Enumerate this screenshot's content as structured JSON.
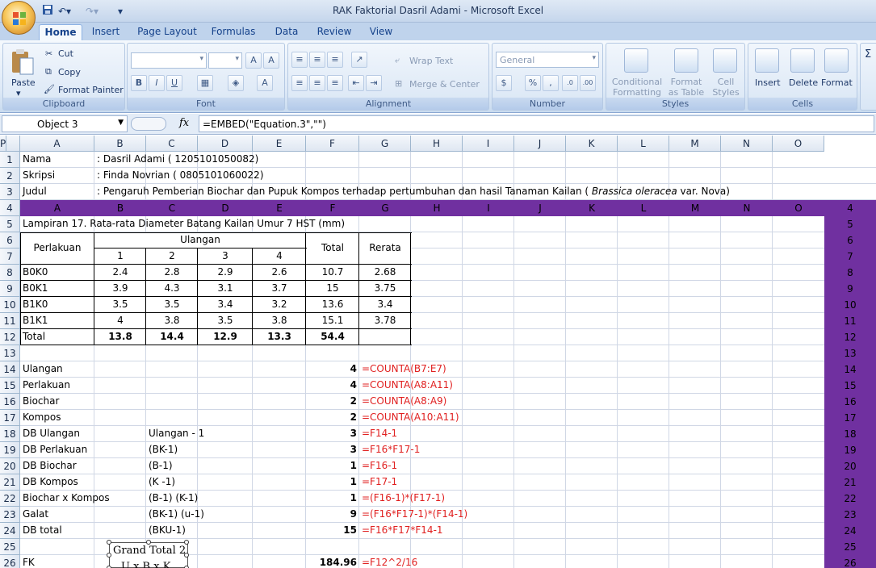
{
  "window": {
    "title": "RAK Faktorial Dasril Adami - Microsoft Excel"
  },
  "ribbon": {
    "tabs": [
      "Home",
      "Insert",
      "Page Layout",
      "Formulas",
      "Data",
      "Review",
      "View"
    ],
    "active_tab": "Home",
    "clipboard": {
      "paste": "Paste",
      "cut": "Cut",
      "copy": "Copy",
      "format_painter": "Format Painter",
      "label": "Clipboard"
    },
    "font": {
      "label": "Font"
    },
    "alignment": {
      "wrap_text": "Wrap Text",
      "merge_center": "Merge & Center",
      "label": "Alignment"
    },
    "number": {
      "format": "General",
      "label": "Number"
    },
    "styles": {
      "conditional_formatting": "Conditional Formatting",
      "format_as_table": "Format as Table",
      "cell_styles": "Cell Styles",
      "label": "Styles"
    },
    "cells": {
      "insert": "Insert",
      "delete": "Delete",
      "format": "Format",
      "label": "Cells"
    }
  },
  "formula_bar": {
    "name_box": "Object 3",
    "fx": "fx",
    "formula": "=EMBED(\"Equation.3\",\"\")"
  },
  "columns": [
    "A",
    "B",
    "C",
    "D",
    "E",
    "F",
    "G",
    "H",
    "I",
    "J",
    "K",
    "L",
    "M",
    "N",
    "O",
    "P"
  ],
  "rows": [
    "1",
    "2",
    "3",
    "4",
    "5",
    "6",
    "7",
    "8",
    "9",
    "10",
    "11",
    "12",
    "13",
    "14",
    "15",
    "16",
    "17",
    "18",
    "19",
    "20",
    "21",
    "22",
    "23",
    "24",
    "25",
    "26"
  ],
  "header_cells": {
    "r1_a": "Nama",
    "r1_b": ": Dasril Adami ( 1205101050082)",
    "r2_a": "Skripsi",
    "r2_b": ": Finda Novrian ( 0805101060022)",
    "r3_a": "Judul",
    "r3_b": ": Pengaruh Pemberian Biochar dan Pupuk Kompos terhadap pertumbuhan dan hasil Tanaman Kailan (",
    "r3_b_italic": "Brassica oleracea",
    "r3_b_end": "var. Nova)"
  },
  "purple_band_columns": [
    "A",
    "B",
    "C",
    "D",
    "E",
    "F",
    "G",
    "H",
    "I",
    "J",
    "K",
    "L",
    "M",
    "N",
    "O"
  ],
  "right_row_labels": [
    "4",
    "5",
    "6",
    "7",
    "8",
    "9",
    "10",
    "11",
    "12",
    "13",
    "14",
    "15",
    "16",
    "17",
    "18",
    "19",
    "20",
    "21",
    "22",
    "23",
    "24",
    "25",
    "26"
  ],
  "table": {
    "caption": "Lampiran 17. Rata-rata Diameter Batang Kailan Umur 7 HST (mm)",
    "h_perlakuan": "Perlakuan",
    "h_ulangan": "Ulangan",
    "h_total": "Total",
    "h_rerata": "Rerata",
    "reps": [
      "1",
      "2",
      "3",
      "4"
    ],
    "rows": [
      {
        "name": "B0K0",
        "v": [
          "2.4",
          "2.8",
          "2.9",
          "2.6"
        ],
        "total": "10.7",
        "mean": "2.68"
      },
      {
        "name": "B0K1",
        "v": [
          "3.9",
          "4.3",
          "3.1",
          "3.7"
        ],
        "total": "15",
        "mean": "3.75"
      },
      {
        "name": "B1K0",
        "v": [
          "3.5",
          "3.5",
          "3.4",
          "3.2"
        ],
        "total": "13.6",
        "mean": "3.4"
      },
      {
        "name": "B1K1",
        "v": [
          "4",
          "3.8",
          "3.5",
          "3.8"
        ],
        "total": "15.1",
        "mean": "3.78"
      }
    ],
    "total_row": {
      "name": "Total",
      "v": [
        "13.8",
        "14.4",
        "12.9",
        "13.3"
      ],
      "total": "54.4"
    }
  },
  "calc_rows": [
    {
      "label": "Ulangan",
      "desc": "",
      "value": "4",
      "formula": "=COUNTA(B7:E7)"
    },
    {
      "label": "Perlakuan",
      "desc": "",
      "value": "4",
      "formula": "=COUNTA(A8:A11)"
    },
    {
      "label": "Biochar",
      "desc": "",
      "value": "2",
      "formula": "=COUNTA(A8:A9)"
    },
    {
      "label": "Kompos",
      "desc": "",
      "value": "2",
      "formula": "=COUNTA(A10:A11)"
    },
    {
      "label": "DB Ulangan",
      "desc": "Ulangan - 1",
      "value": "3",
      "formula": "=F14-1"
    },
    {
      "label": "DB Perlakuan",
      "desc": "(BK-1)",
      "value": "3",
      "formula": "=F16*F17-1"
    },
    {
      "label": "DB Biochar",
      "desc": "(B-1)",
      "value": "1",
      "formula": "=F16-1"
    },
    {
      "label": "DB Kompos",
      "desc": "(K -1)",
      "value": "1",
      "formula": "=F17-1"
    },
    {
      "label": "Biochar x Kompos",
      "desc": "(B-1) (K-1)",
      "value": "1",
      "formula": "=(F16-1)*(F17-1)"
    },
    {
      "label": "Galat",
      "desc": "(BK-1) (u-1)",
      "value": "9",
      "formula": "=(F16*F17-1)*(F14-1)"
    },
    {
      "label": "DB total",
      "desc": "(BKU-1)",
      "value": "15",
      "formula": "=F16*F17*F14-1"
    },
    {
      "label": "",
      "desc": "",
      "value": "",
      "formula": ""
    },
    {
      "label": "FK",
      "desc": "",
      "value": "184.96",
      "formula": "=F12^2/16"
    }
  ],
  "equation_object": {
    "line1": "Grand Total 2",
    "line2": "U x B x K"
  },
  "colors": {
    "band": "#7030a0",
    "formula_text": "#e02020"
  }
}
